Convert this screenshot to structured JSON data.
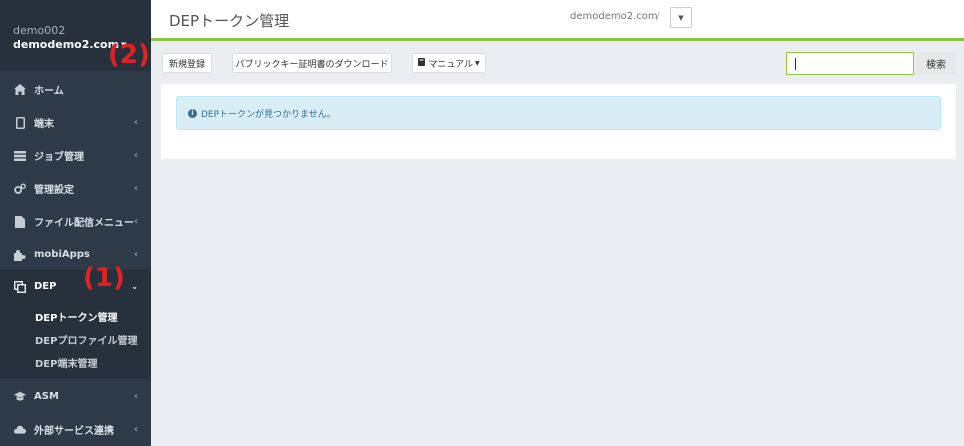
{
  "account": {
    "org": "demo002",
    "user": "demodemo2.com"
  },
  "sidebar": {
    "items": [
      {
        "label": "ホーム",
        "icon": "home-icon",
        "has_chevron": false
      },
      {
        "label": "端末",
        "icon": "tablet-icon",
        "has_chevron": true
      },
      {
        "label": "ジョブ管理",
        "icon": "server-icon",
        "has_chevron": true
      },
      {
        "label": "管理設定",
        "icon": "gears-icon",
        "has_chevron": true
      },
      {
        "label": "ファイル配信メニュー",
        "icon": "file-icon",
        "has_chevron": true
      },
      {
        "label": "mobiApps",
        "icon": "puzzle-icon",
        "has_chevron": true
      },
      {
        "label": "DEP",
        "icon": "copy-icon",
        "has_chevron": true,
        "expanded": true
      },
      {
        "label": "ASM",
        "icon": "graduation-cap-icon",
        "has_chevron": true
      },
      {
        "label": "外部サービス連携",
        "icon": "cloud-icon",
        "has_chevron": true
      }
    ],
    "dep_submenu": [
      {
        "label": "DEPトークン管理",
        "current": true
      },
      {
        "label": "DEPプロファイル管理",
        "current": false
      },
      {
        "label": "DEP端末管理",
        "current": false
      }
    ]
  },
  "header": {
    "title": "DEPトークン管理",
    "domain": "demodemo2.com",
    "separator": "/"
  },
  "toolbar": {
    "new_label": "新規登録",
    "download_label": "パブリックキー証明書のダウンロード",
    "manual_label": "マニュアル",
    "search_value": "",
    "search_button": "検索"
  },
  "main": {
    "alert_text": "DEPトークンが見つかりません。"
  },
  "annotations": {
    "marker_1": "(1)",
    "marker_2": "(2)"
  },
  "colors": {
    "sidebar_bg": "#2e3a47",
    "accent_green": "#8cc63f",
    "alert_bg": "#d9edf7",
    "alert_text": "#31708f",
    "marker_red": "#e02222"
  }
}
